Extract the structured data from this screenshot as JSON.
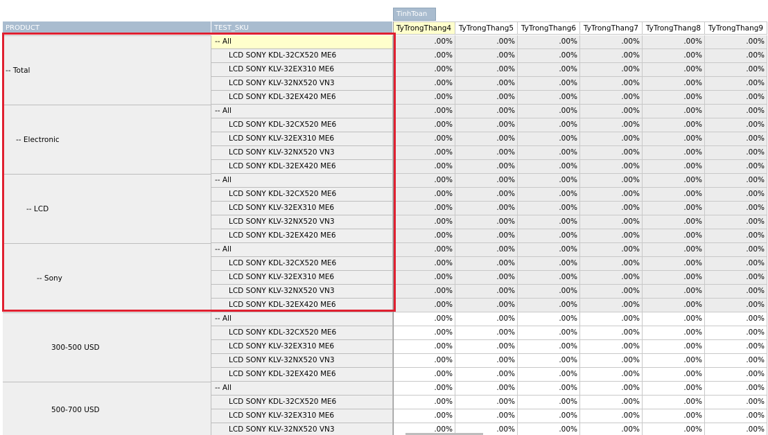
{
  "header": {
    "measure_group": "TinhToan",
    "product_col": "PRODUCT",
    "sku_col": "TEST_SKU",
    "columns": [
      "TyTrongThang4",
      "TyTrongThang5",
      "TyTrongThang6",
      "TyTrongThang7",
      "TyTrongThang8",
      "TyTrongThang9"
    ],
    "selected_column_index": 0
  },
  "sku_labels": {
    "all": "-- All",
    "items": [
      "LCD SONY KDL-32CX520 ME6",
      "LCD SONY KLV-32EX310 ME6",
      "LCD SONY KLV-32NX520 VN3",
      "LCD SONY KDL-32EX420 ME6"
    ]
  },
  "groups": [
    {
      "label": "-- Total",
      "indent": 1,
      "rows": 5,
      "shaded": true
    },
    {
      "label": "-- Electronic",
      "indent": 2,
      "rows": 5,
      "shaded": true
    },
    {
      "label": "-- LCD",
      "indent": 3,
      "rows": 5,
      "shaded": true
    },
    {
      "label": "-- Sony",
      "indent": 4,
      "rows": 5,
      "shaded": true
    },
    {
      "label": "300-500 USD",
      "indent": 5,
      "rows": 5,
      "shaded": false
    },
    {
      "label": "500-700 USD",
      "indent": 5,
      "rows": 4,
      "shaded": false
    }
  ],
  "cell_value": ".00%",
  "colors": {
    "header_blue": "#a9bccf",
    "selection": "#e02030",
    "highlight": "#ffffcc",
    "shaded": "#ececec",
    "row_grey": "#efefef"
  }
}
